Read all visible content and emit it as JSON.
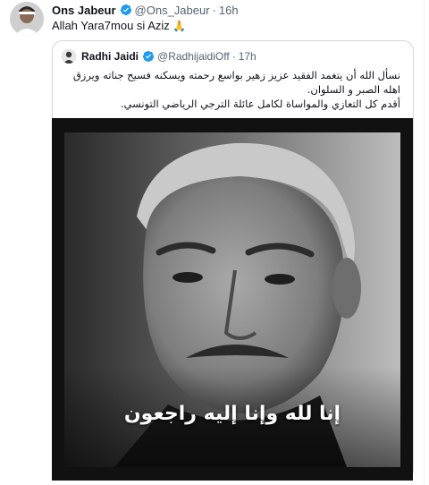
{
  "tweet": {
    "author_name": "Ons Jabeur",
    "author_handle": "@Ons_Jabeur",
    "separator": "·",
    "time": "16h",
    "text": "Allah Yara7mou si Aziz",
    "emoji": "🙏"
  },
  "quote": {
    "author_name": "Radhi Jaidi",
    "author_handle": "@RadhijaidiOff",
    "separator": "·",
    "time": "17h",
    "lines": [
      "نسأل الله أن يتغمد الفقيد عزيز زهير بواسع رحمته ويسكنه فسيح جناته ويرزق",
      "اهله الصبر و السلوان.",
      "أقدم كل التعازي والمواساة لكامل عائلة الترجي الرياضي التونسي."
    ],
    "image_caption": "إنا لله وإنا إليه راجعون"
  },
  "colors": {
    "verified": "#1d9bf0",
    "secondary_text": "#536471",
    "border": "#cfd9de"
  }
}
